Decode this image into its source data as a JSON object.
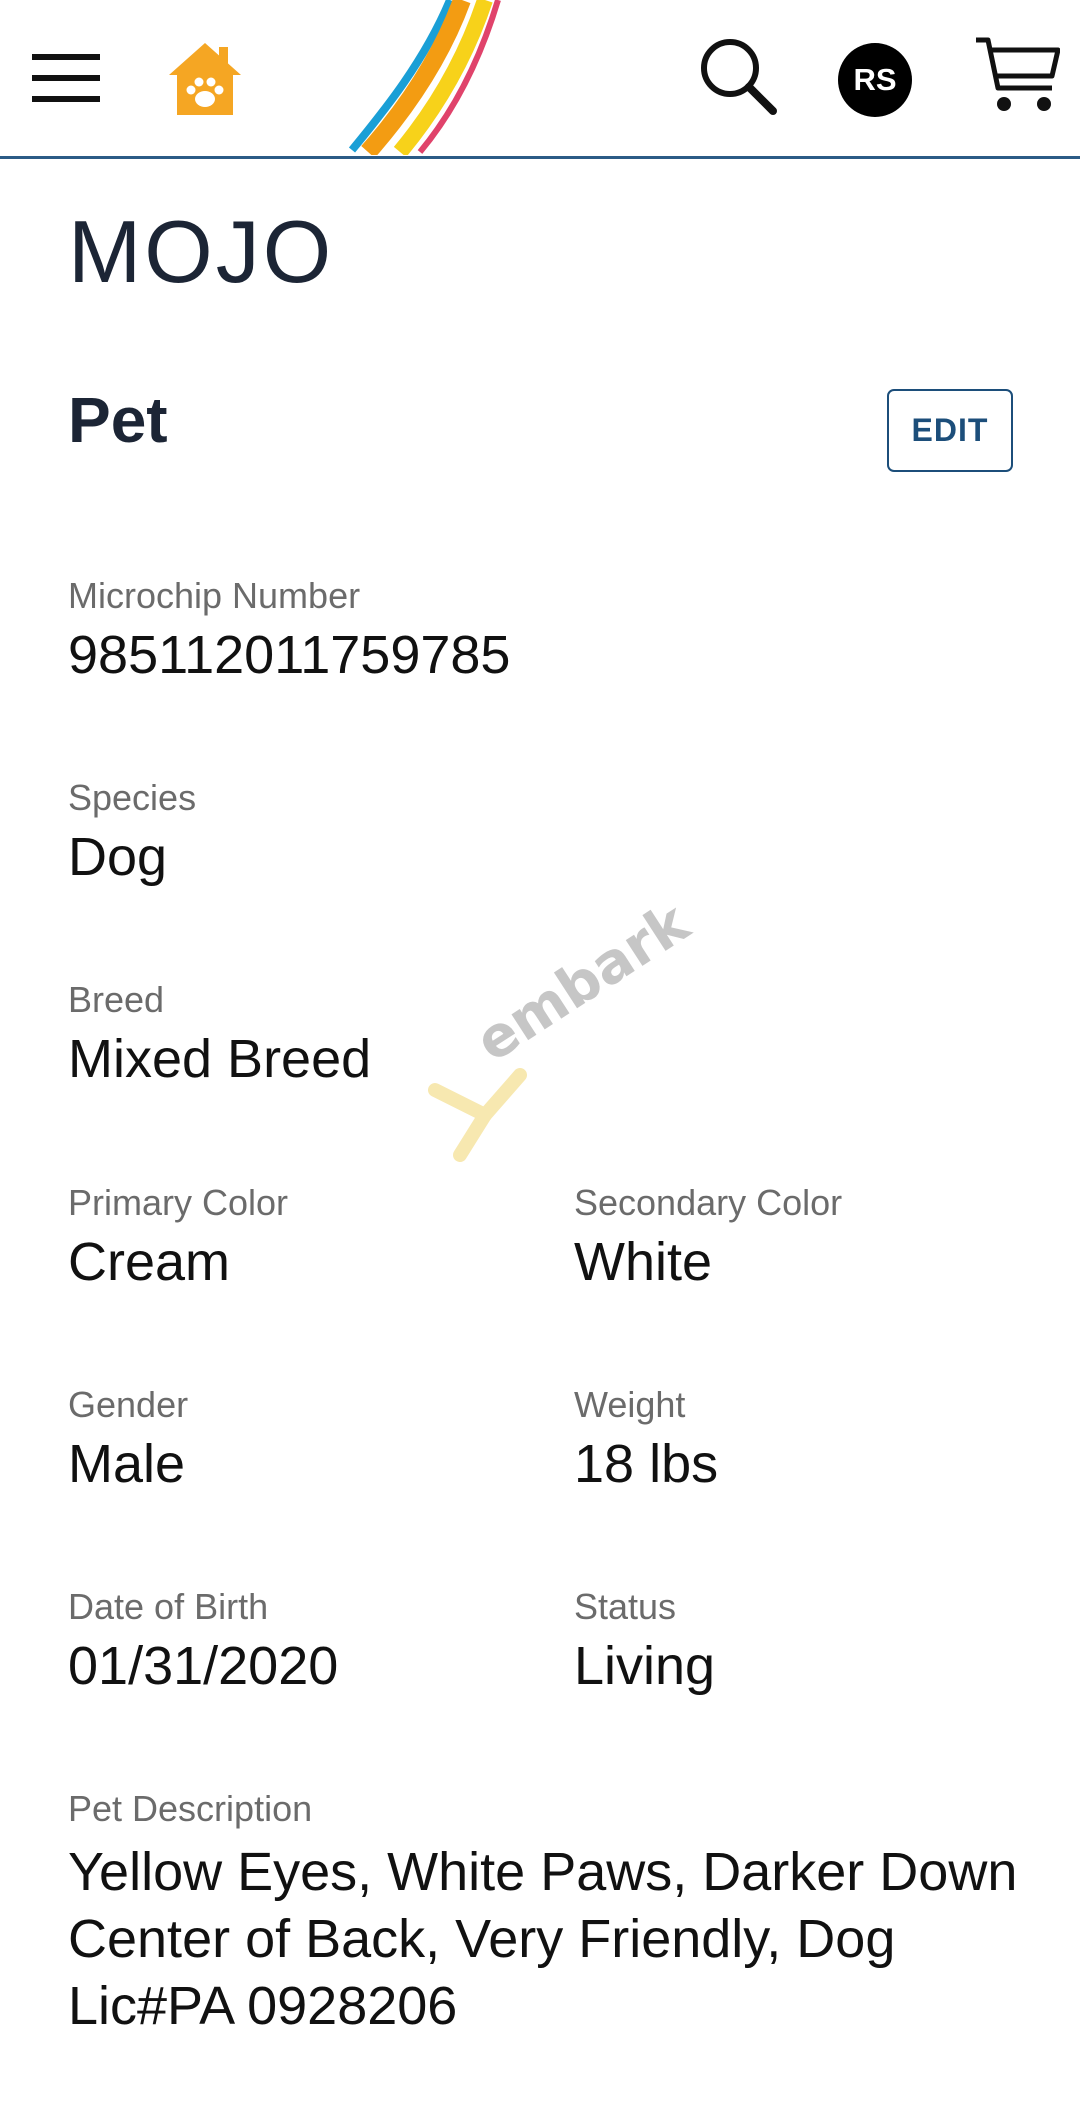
{
  "header": {
    "avatar_initials": "RS",
    "icons": [
      "menu-icon",
      "home-paw-icon",
      "logo-stripes",
      "search-icon",
      "cart-icon"
    ],
    "colors": {
      "home_icon": "#f5a623",
      "header_border": "#2b5b86",
      "avatar_bg": "#000000"
    }
  },
  "pet": {
    "name": "MOJO",
    "section_title": "Pet",
    "edit_label": "EDIT",
    "fields": {
      "microchip": {
        "label": "Microchip Number",
        "value": "985112011759785"
      },
      "species": {
        "label": "Species",
        "value": "Dog"
      },
      "breed": {
        "label": "Breed",
        "value": "Mixed Breed"
      },
      "primary_color": {
        "label": "Primary Color",
        "value": "Cream"
      },
      "secondary_color": {
        "label": "Secondary Color",
        "value": "White"
      },
      "gender": {
        "label": "Gender",
        "value": "Male"
      },
      "weight": {
        "label": "Weight",
        "value": "18 lbs"
      },
      "dob": {
        "label": "Date of Birth",
        "value": "01/31/2020"
      },
      "status": {
        "label": "Status",
        "value": "Living"
      },
      "description": {
        "label": "Pet Description",
        "value": "Yellow Eyes, White Paws, Darker Down Center of Back, Very Friendly, Dog Lic#PA 0928206"
      }
    }
  },
  "watermark": {
    "text": "embark"
  }
}
